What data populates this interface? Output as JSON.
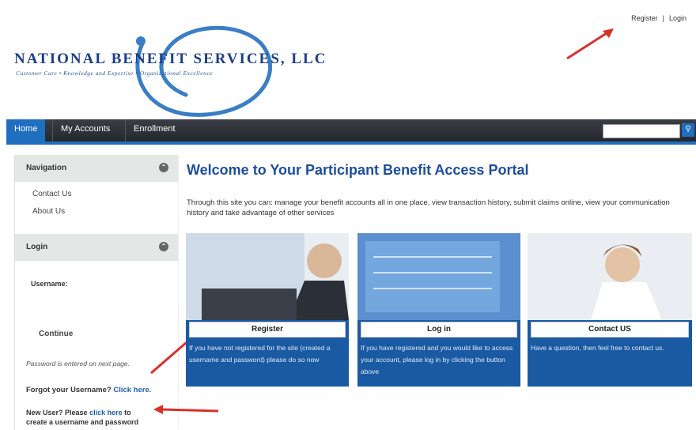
{
  "header": {
    "register_link": "Register",
    "separator": "|",
    "login_link": "Login",
    "logo_name": "NATIONAL BENEFIT SERVICES, LLC",
    "logo_tagline": "Customer Care • Knowledge and Expertise • Organizational Excellence"
  },
  "nav": {
    "tabs": [
      {
        "label": "Home"
      },
      {
        "label": "My Accounts"
      },
      {
        "label": "Enrollment"
      }
    ],
    "search_placeholder": "",
    "search_icon": "search-icon"
  },
  "sidebar": {
    "navigation_title": "Navigation",
    "navigation_items": [
      {
        "label": "Contact Us"
      },
      {
        "label": "About Us"
      }
    ],
    "login_title": "Login",
    "username_label": "Username:",
    "continue_label": "Continue",
    "password_note": "Password is entered on next page.",
    "forgot_text": "Forgot your Username?",
    "forgot_link": "Click here.",
    "new_user_text": "New User? Please",
    "new_user_link": "click here",
    "new_user_rest_1": "to",
    "new_user_rest_2": "create a username and password"
  },
  "main": {
    "title": "Welcome to Your Participant Benefit Access Portal",
    "intro": "Through this site you can: manage your benefit accounts all in one place, view transaction history, submit claims online, view your communication history and take advantage of other services",
    "cards": [
      {
        "button": "Register",
        "text": "If you have not registered for the site (created a username and password) please do so now"
      },
      {
        "button": "Log in",
        "text": "If you have registered and you would like to access your account, please log in by clicking the button above"
      },
      {
        "button": "Contact US",
        "text": "Have a question, then feel free to contact us."
      }
    ]
  },
  "colors": {
    "brand_blue": "#1f6fbf",
    "card_blue": "#1a5aa3",
    "nav_dark": "#2e3137",
    "arrow_red": "#d9302a"
  }
}
